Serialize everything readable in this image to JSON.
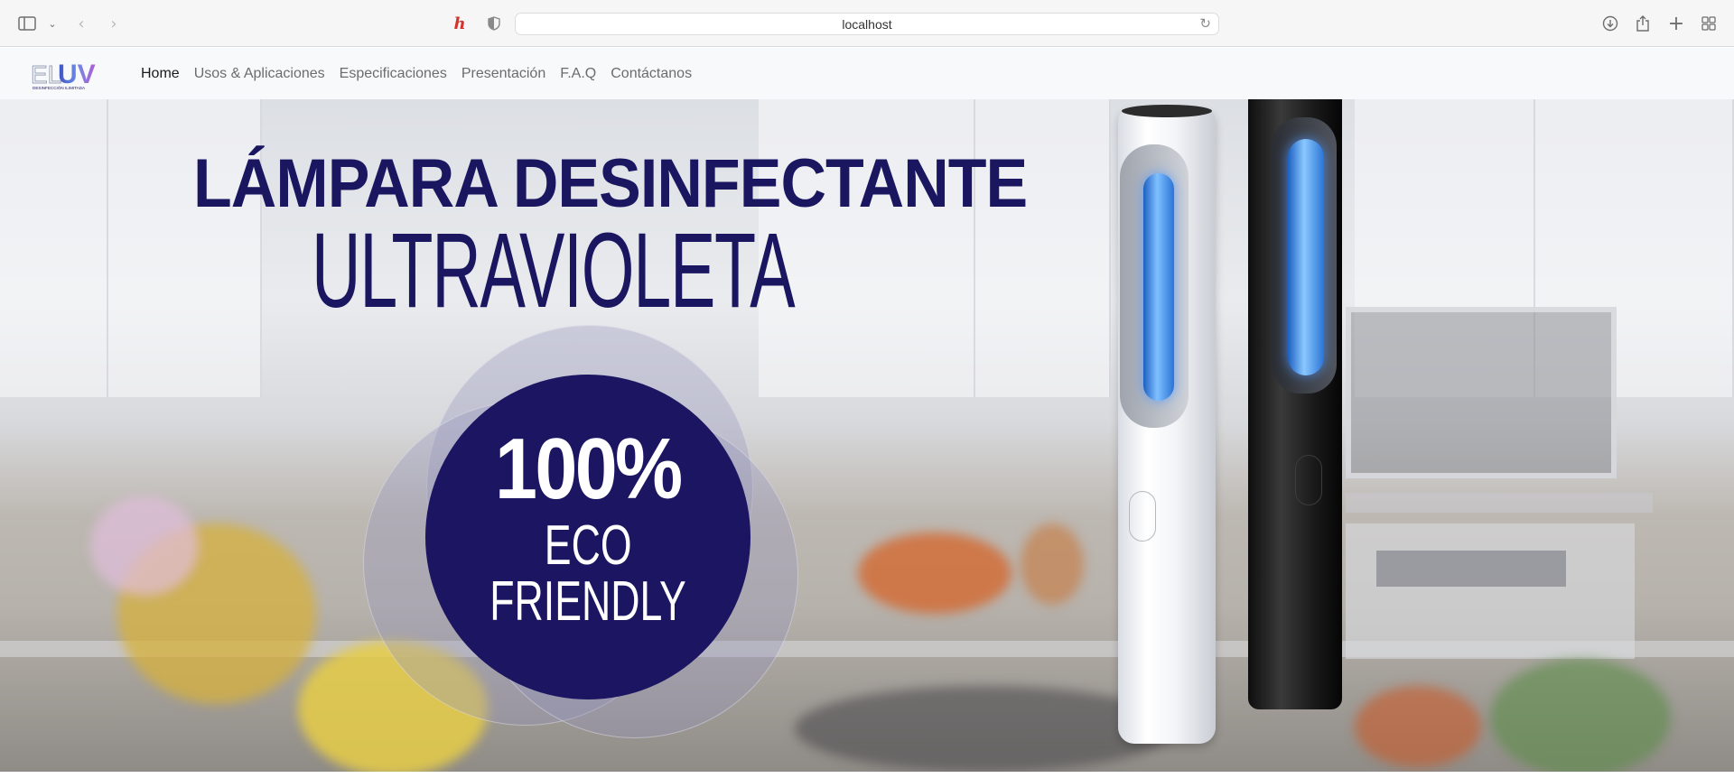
{
  "browser": {
    "url": "localhost",
    "icons": {
      "sidebar": "sidebar-icon",
      "back": "chevron-left-icon",
      "forward": "chevron-right-icon",
      "extension": "honey-extension-icon",
      "shield": "privacy-shield-icon",
      "reload": "reload-icon",
      "download": "download-icon",
      "share": "share-icon",
      "new_tab": "plus-icon",
      "tabs": "tab-overview-icon"
    }
  },
  "site": {
    "logo_text": "ELUV",
    "logo_tagline": "DESINFECCIÓN ILIMITADA",
    "nav": [
      {
        "label": "Home",
        "active": true
      },
      {
        "label": "Usos & Aplicaciones",
        "active": false
      },
      {
        "label": "Especificaciones",
        "active": false
      },
      {
        "label": "Presentación",
        "active": false
      },
      {
        "label": "F.A.Q",
        "active": false
      },
      {
        "label": "Contáctanos",
        "active": false
      }
    ]
  },
  "hero": {
    "title_line1": "LÁMPARA DESINFECTANTE",
    "title_line2": "ULTRAVIOLETA",
    "badge_percent": "100%",
    "badge_line1": "ECO",
    "badge_line2": "FRIENDLY",
    "colors": {
      "brand_navy": "#1b1562",
      "uv_blue": "#6fb6ff"
    }
  }
}
